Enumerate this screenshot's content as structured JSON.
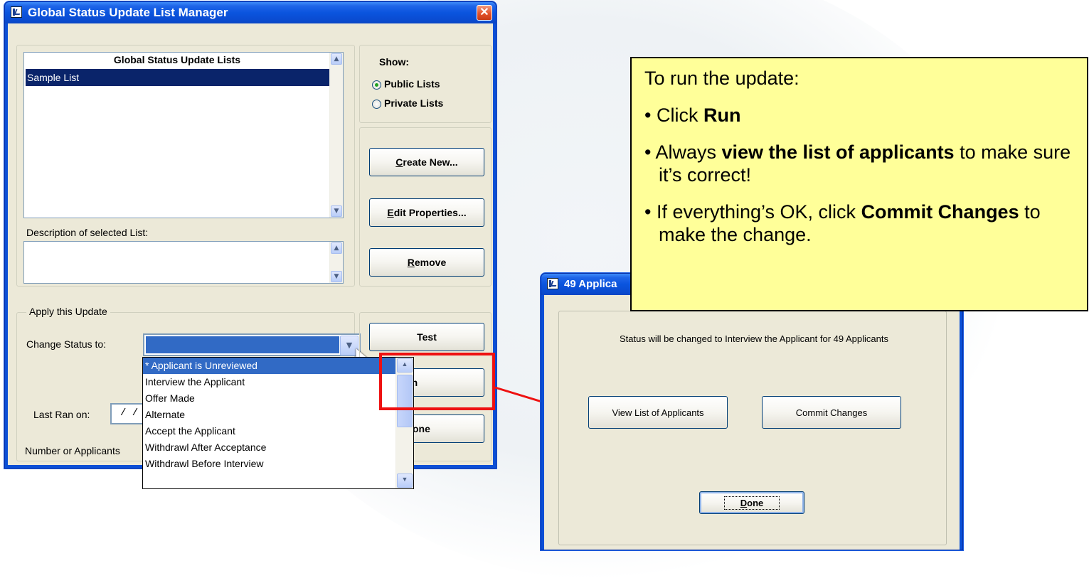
{
  "manager": {
    "title": "Global Status Update List Manager",
    "close_glyph": "✕",
    "lists_header": "Global Status Update Lists",
    "lists": [
      "Sample List"
    ],
    "description_label": "Description of selected List:",
    "description_value": "",
    "show_label": "Show:",
    "show_options": [
      {
        "label": "Public Lists",
        "checked": true
      },
      {
        "label": "Private Lists",
        "checked": false
      }
    ],
    "buttons": {
      "create_new": {
        "mnemonic": "C",
        "rest": "reate New..."
      },
      "edit_properties": {
        "mnemonic": "E",
        "rest": "dit Properties..."
      },
      "remove": {
        "mnemonic": "R",
        "rest": "emove"
      },
      "test": "Test",
      "run": "Run",
      "done": "one"
    },
    "apply_group_label": "Apply this Update",
    "change_status_label": "Change Status to:",
    "change_status_value": "",
    "last_ran_label": "Last Ran on:",
    "last_ran_value": "/ /",
    "number_label": "Number or Applicants",
    "status_options": [
      "* Applicant is Unreviewed",
      "Interview the Applicant",
      "Offer Made",
      "Alternate",
      "Accept the Applicant",
      "Withdrawl After Acceptance",
      "Withdrawl Before Interview"
    ]
  },
  "confirm": {
    "title": "49 Applica",
    "message": "Status will be changed to Interview the Applicant for 49 Applicants",
    "view_list_button": "View List of Applicants",
    "commit_button": "Commit Changes",
    "done_button": {
      "mnemonic": "D",
      "rest": "one"
    }
  },
  "callout": {
    "heading": "To run the update:",
    "b1_pre": "• Click ",
    "b1_bold": "Run",
    "b2_pre": "• Always ",
    "b2_bold": "view the list of applicants",
    "b2_post": " to make sure it’s correct!",
    "b3_pre": "• If everything’s OK,  click ",
    "b3_bold": "Commit Changes",
    "b3_post": " to make the change."
  },
  "colors": {
    "highlight_box": "#ee1111",
    "callout_bg": "#ffff99",
    "selection": "#316ac5",
    "titlebar": "#0a54de"
  }
}
